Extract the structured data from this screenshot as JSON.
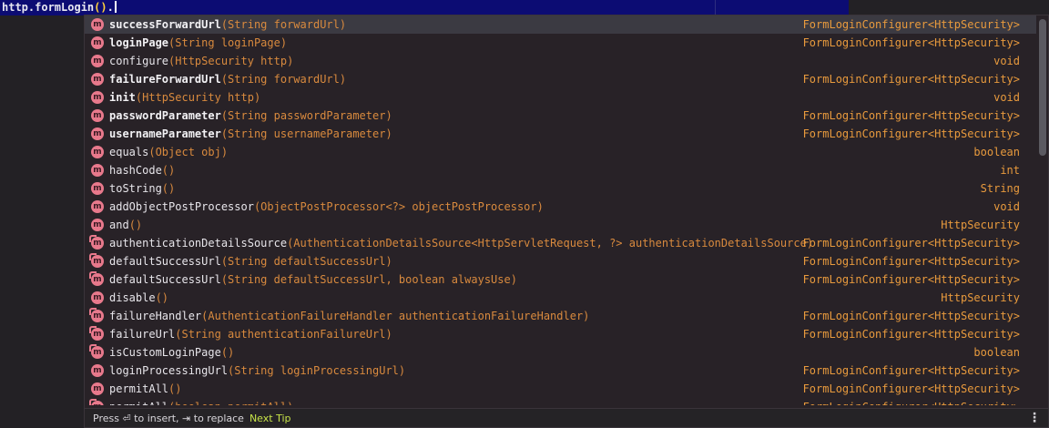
{
  "editor": {
    "code_prefix": "http.formLogin",
    "open_paren": "(",
    "close_paren": ")",
    "dot": "."
  },
  "completion": {
    "items": [
      {
        "icon": "m",
        "name": "successForwardUrl",
        "params": "(String forwardUrl)",
        "type": "FormLoginConfigurer<HttpSecurity>",
        "bold": true,
        "inherited": false,
        "selected": true
      },
      {
        "icon": "m",
        "name": "loginPage",
        "params": "(String loginPage)",
        "type": "FormLoginConfigurer<HttpSecurity>",
        "bold": true,
        "inherited": false
      },
      {
        "icon": "m",
        "name": "configure",
        "params": "(HttpSecurity http)",
        "type": "void",
        "bold": false,
        "inherited": false
      },
      {
        "icon": "m",
        "name": "failureForwardUrl",
        "params": "(String forwardUrl)",
        "type": "FormLoginConfigurer<HttpSecurity>",
        "bold": true,
        "inherited": false
      },
      {
        "icon": "m",
        "name": "init",
        "params": "(HttpSecurity http)",
        "type": "void",
        "bold": true,
        "inherited": false
      },
      {
        "icon": "m",
        "name": "passwordParameter",
        "params": "(String passwordParameter)",
        "type": "FormLoginConfigurer<HttpSecurity>",
        "bold": true,
        "inherited": false
      },
      {
        "icon": "m",
        "name": "usernameParameter",
        "params": "(String usernameParameter)",
        "type": "FormLoginConfigurer<HttpSecurity>",
        "bold": true,
        "inherited": false
      },
      {
        "icon": "m",
        "name": "equals",
        "params": "(Object obj)",
        "type": "boolean",
        "bold": false,
        "inherited": false
      },
      {
        "icon": "m",
        "name": "hashCode",
        "params": "()",
        "type": "int",
        "bold": false,
        "inherited": false
      },
      {
        "icon": "m",
        "name": "toString",
        "params": "()",
        "type": "String",
        "bold": false,
        "inherited": false
      },
      {
        "icon": "m",
        "name": "addObjectPostProcessor",
        "params": "(ObjectPostProcessor<?> objectPostProcessor)",
        "type": "void",
        "bold": false,
        "inherited": false
      },
      {
        "icon": "m",
        "name": "and",
        "params": "()",
        "type": "HttpSecurity",
        "bold": false,
        "inherited": false
      },
      {
        "icon": "m",
        "name": "authenticationDetailsSource",
        "params": "(AuthenticationDetailsSource<HttpServletRequest, ?> authenticationDetailsSource)",
        "type": "FormLoginConfigurer<HttpSecurity>",
        "bold": false,
        "inherited": true
      },
      {
        "icon": "m",
        "name": "defaultSuccessUrl",
        "params": "(String defaultSuccessUrl)",
        "type": "FormLoginConfigurer<HttpSecurity>",
        "bold": false,
        "inherited": true
      },
      {
        "icon": "m",
        "name": "defaultSuccessUrl",
        "params": "(String defaultSuccessUrl, boolean alwaysUse)",
        "type": "FormLoginConfigurer<HttpSecurity>",
        "bold": false,
        "inherited": true
      },
      {
        "icon": "m",
        "name": "disable",
        "params": "()",
        "type": "HttpSecurity",
        "bold": false,
        "inherited": false
      },
      {
        "icon": "m",
        "name": "failureHandler",
        "params": "(AuthenticationFailureHandler authenticationFailureHandler)",
        "type": "FormLoginConfigurer<HttpSecurity>",
        "bold": false,
        "inherited": true
      },
      {
        "icon": "m",
        "name": "failureUrl",
        "params": "(String authenticationFailureUrl)",
        "type": "FormLoginConfigurer<HttpSecurity>",
        "bold": false,
        "inherited": true
      },
      {
        "icon": "m",
        "name": "isCustomLoginPage",
        "params": "()",
        "type": "boolean",
        "bold": false,
        "inherited": true
      },
      {
        "icon": "m",
        "name": "loginProcessingUrl",
        "params": "(String loginProcessingUrl)",
        "type": "FormLoginConfigurer<HttpSecurity>",
        "bold": false,
        "inherited": false
      },
      {
        "icon": "m",
        "name": "permitAll",
        "params": "()",
        "type": "FormLoginConfigurer<HttpSecurity>",
        "bold": false,
        "inherited": false
      },
      {
        "icon": "m",
        "name": "permitAll",
        "params": "(boolean permitAll)",
        "type": "FormLoginConfigurer<HttpSecurity>",
        "bold": false,
        "inherited": true
      }
    ],
    "status": {
      "hint": "Press ⏎ to insert, ⇥ to replace",
      "next_tip": "Next Tip",
      "more_icon": "⋮"
    }
  }
}
